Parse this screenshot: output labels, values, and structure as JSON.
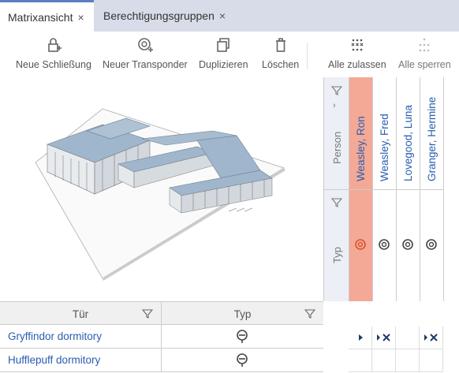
{
  "tabs": [
    {
      "label": "Matrixansicht",
      "close": "×"
    },
    {
      "label": "Berechtigungsgruppen",
      "close": "×"
    }
  ],
  "toolbar": {
    "new_lock": "Neue Schließung",
    "new_transponder": "Neuer Transponder",
    "duplicate": "Duplizieren",
    "delete": "Löschen",
    "allow_all": "Alle zulassen",
    "lock_all": "Alle sperren"
  },
  "matrix": {
    "person_label": "Person",
    "type_label": "Typ",
    "persons": [
      {
        "name": "Weasley, Ron",
        "selected": true
      },
      {
        "name": "Weasley, Fred",
        "selected": false
      },
      {
        "name": "Lovegood, Luna",
        "selected": false
      },
      {
        "name": "Granger, Hermine",
        "selected": false
      }
    ]
  },
  "table": {
    "col_door": "Tür",
    "col_type": "Typ",
    "rows": [
      {
        "name": "Gryffindor dormitory"
      },
      {
        "name": "Hufflepuff dormitory"
      }
    ]
  },
  "colors": {
    "accent": "#5b7fbf",
    "selected": "#f3a996",
    "link": "#2a5db0",
    "icon_selected": "#d9542c"
  }
}
